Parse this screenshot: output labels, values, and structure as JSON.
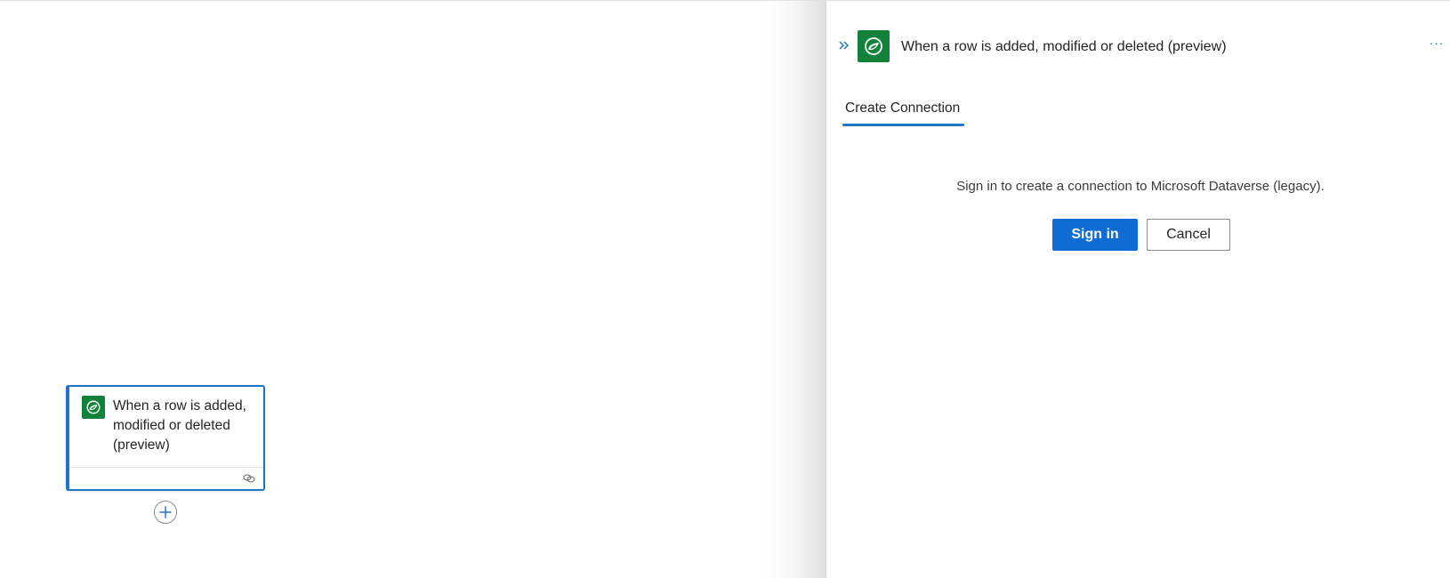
{
  "canvas": {
    "trigger_card": {
      "title": "When a row is added, modified or deleted (preview)",
      "connector_icon": "dataverse-icon",
      "footer_icon": "link-icon"
    },
    "add_step_icon": "plus-icon"
  },
  "panel": {
    "collapse_icon": "double-chevron-right-icon",
    "connector_icon": "dataverse-icon",
    "title": "When a row is added, modified or deleted (preview)",
    "more_label": "···",
    "tabs": [
      {
        "label": "Create Connection",
        "selected": true
      }
    ],
    "message": "Sign in to create a connection to Microsoft Dataverse (legacy).",
    "sign_in_label": "Sign in",
    "cancel_label": "Cancel"
  },
  "colors": {
    "accent": "#1f74c4",
    "connector_green": "#12823b",
    "primary_button": "#0f6cd4"
  }
}
